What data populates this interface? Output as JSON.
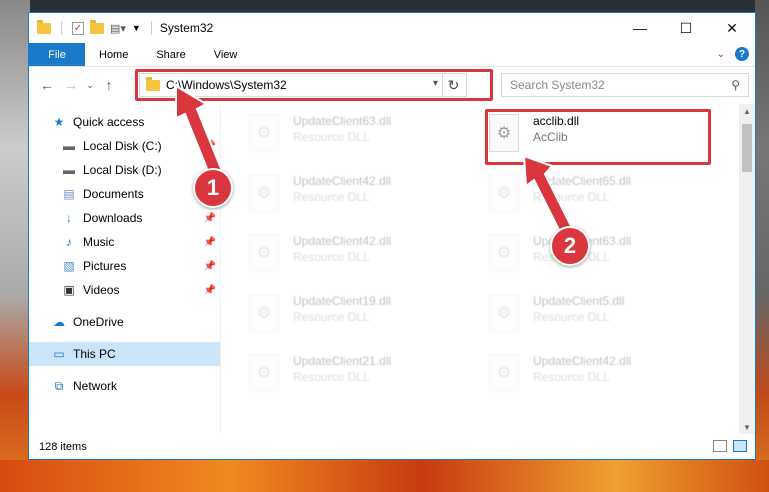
{
  "window": {
    "title": "System32",
    "controls": [
      "—",
      "☐",
      "✕"
    ]
  },
  "ribbon": {
    "file_label": "File",
    "tabs": [
      "Home",
      "Share",
      "View"
    ]
  },
  "address": {
    "path": "C:\\Windows\\System32",
    "search_placeholder": "Search System32"
  },
  "nav": {
    "quick_access": "Quick access",
    "items": [
      {
        "label": "Local Disk (C:)",
        "icon": "drive-icon",
        "pinned": true
      },
      {
        "label": "Local Disk (D:)",
        "icon": "drive-icon",
        "pinned": true
      },
      {
        "label": "Documents",
        "icon": "documents-icon",
        "pinned": true
      },
      {
        "label": "Downloads",
        "icon": "downloads-icon",
        "pinned": true
      },
      {
        "label": "Music",
        "icon": "music-icon",
        "pinned": true
      },
      {
        "label": "Pictures",
        "icon": "pictures-icon",
        "pinned": true
      },
      {
        "label": "Videos",
        "icon": "videos-icon",
        "pinned": true
      }
    ],
    "onedrive": "OneDrive",
    "this_pc": "This PC",
    "network": "Network"
  },
  "files": {
    "left_column": [
      {
        "name": "UpdateClient63.dll",
        "type": "Resource DLL"
      },
      {
        "name": "UpdateClient42.dll",
        "type": "Resource DLL"
      },
      {
        "name": "UpdateClient42.dll",
        "type": "Resource DLL"
      },
      {
        "name": "UpdateClient19.dll",
        "type": "Resource DLL"
      },
      {
        "name": "UpdateClient21.dll",
        "type": "Resource DLL"
      }
    ],
    "right_column": [
      {
        "name": "acclib.dll",
        "type": "AcClib"
      },
      {
        "name": "UpdateClient65.dll",
        "type": "Resource DLL"
      },
      {
        "name": "UpdateClient63.dll",
        "type": "Resource DLL"
      },
      {
        "name": "UpdateClient5.dll",
        "type": "Resource DLL"
      },
      {
        "name": "UpdateClient42.dll",
        "type": "Resource DLL"
      }
    ]
  },
  "status": {
    "item_count": "128 items"
  },
  "callouts": {
    "one": "1",
    "two": "2"
  },
  "colors": {
    "accent": "#1979ca",
    "highlight": "#d9363e"
  }
}
